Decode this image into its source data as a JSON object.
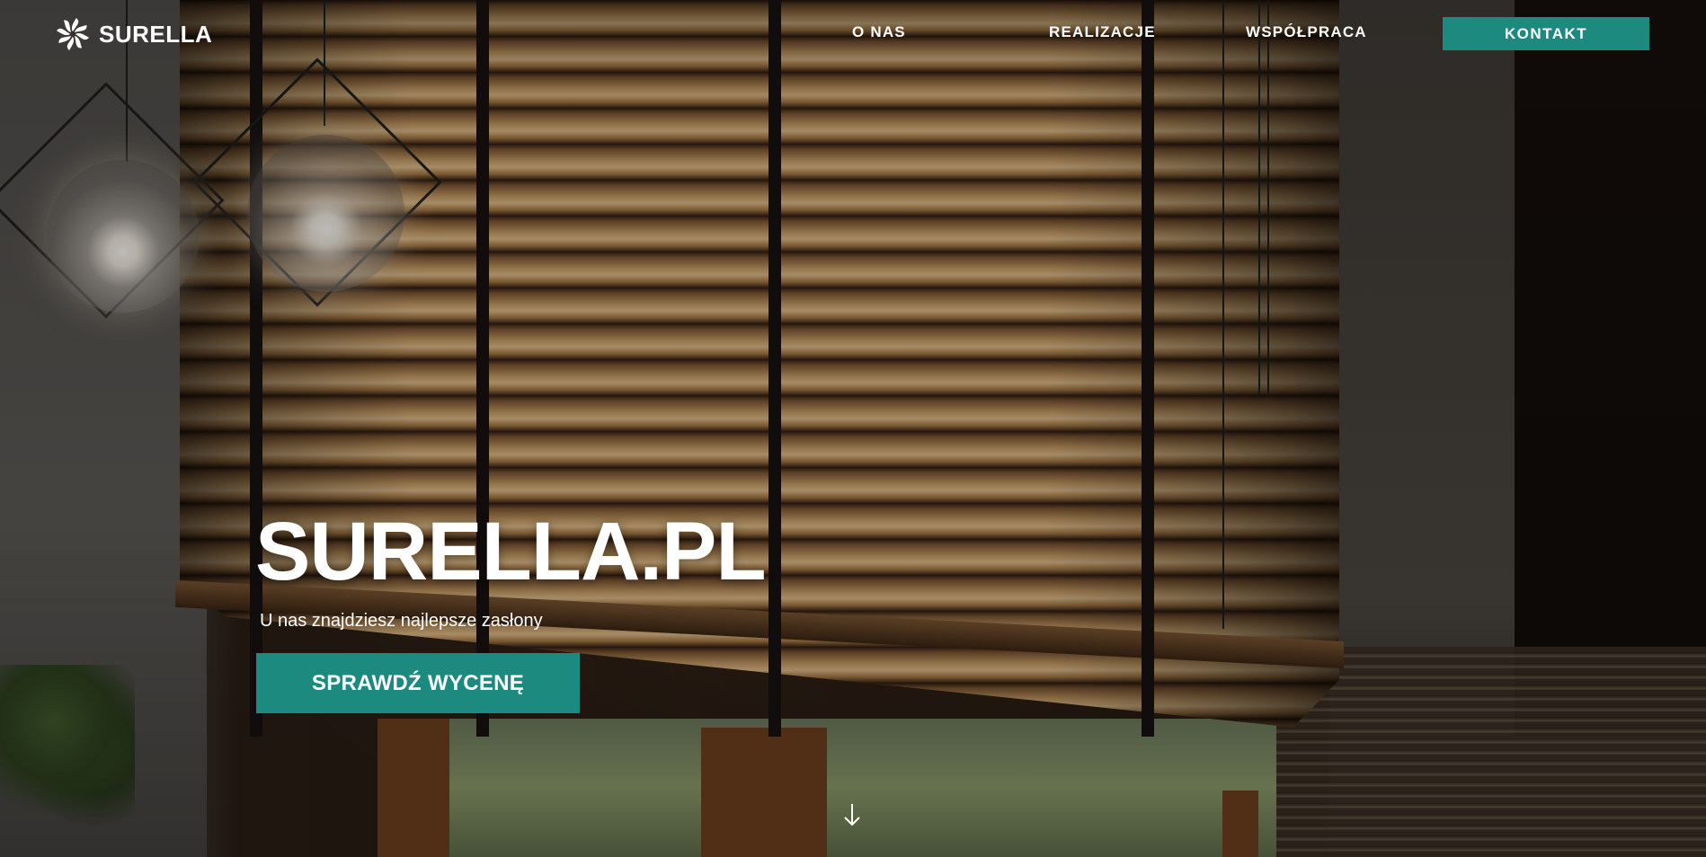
{
  "brand": {
    "name": "SURELLA",
    "icon": "pinwheel-logo-icon"
  },
  "nav": {
    "items": [
      {
        "label": "O NAS"
      },
      {
        "label": "REALIZACJE"
      },
      {
        "label": "WSPÓŁPRACA"
      }
    ],
    "cta_label": "KONTAKT"
  },
  "hero": {
    "title": "SURELLA.PL",
    "subtitle": "U nas znajdziesz najlepsze zasłony",
    "button_label": "SPRAWDŹ WYCENĘ",
    "scroll_icon": "arrow-down-icon"
  },
  "colors": {
    "accent": "#1d8a80",
    "text": "#ffffff"
  }
}
